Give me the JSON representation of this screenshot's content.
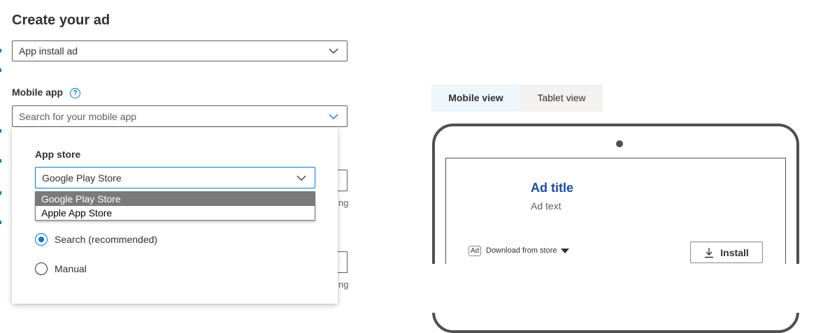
{
  "page": {
    "title": "Create your ad"
  },
  "ad_type_select": {
    "value": "App install ad"
  },
  "mobile_app": {
    "label": "Mobile app",
    "help_glyph": "?",
    "search_placeholder": "Search for your mobile app"
  },
  "app_store_popup": {
    "label": "App store",
    "selected_value": "Google Play Store",
    "options": [
      "Google Play Store",
      "Apple App Store"
    ],
    "radio_options": [
      {
        "label": "Search (recommended)",
        "checked": true
      },
      {
        "label": "Manual",
        "checked": false
      }
    ]
  },
  "truncated_text": {
    "row1": "ng",
    "row2": "ng"
  },
  "preview": {
    "tabs": [
      {
        "label": "Mobile view",
        "active": true
      },
      {
        "label": "Tablet view",
        "active": false
      }
    ],
    "ad_title": "Ad title",
    "ad_text": "Ad text",
    "ad_badge": "Ad",
    "download_label": "Download from store",
    "install_label": "Install"
  },
  "colors": {
    "accent": "#0078d4",
    "ad_title": "#1a49b8",
    "selected_option_bg": "#7a7a7a",
    "active_tab_bg": "#eff6fc",
    "inactive_tab_bg": "#f3f2f1"
  }
}
